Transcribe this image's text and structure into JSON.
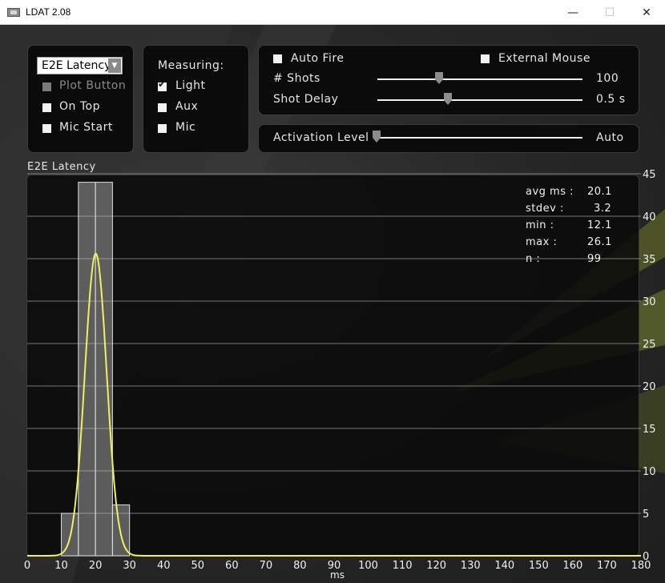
{
  "window": {
    "title": "LDAT 2.08",
    "minimize": "—",
    "maximize": "☐",
    "close": "✕"
  },
  "colors": {
    "accent_curve": "#f0f060",
    "bar_fill": "#bdbdbd",
    "panel": "#0b0b0b"
  },
  "left_panel": {
    "dropdown_value": "E2E Latency",
    "plot_button": "Plot Button",
    "on_top": "On Top",
    "mic_start": "Mic Start"
  },
  "measuring": {
    "title": "Measuring:",
    "light": "Light",
    "aux": "Aux",
    "mic": "Mic",
    "light_checked": true
  },
  "controls": {
    "auto_fire": "Auto Fire",
    "external_mouse": "External Mouse",
    "shots_label": "# Shots",
    "shots_value": "100",
    "shot_delay_label": "Shot Delay",
    "shot_delay_value": "0.5  s",
    "activation_label": "Activation Level",
    "activation_value": "Auto"
  },
  "chart_title": "E2E Latency",
  "stats": {
    "avg_label": "avg ms :",
    "avg": "20.1",
    "stdev_label": "stdev :",
    "stdev": "3.2",
    "min_label": "min :",
    "min": "12.1",
    "max_label": "max :",
    "max": "26.1",
    "n_label": "n :",
    "n": "99"
  },
  "chart_data": {
    "type": "bar",
    "xlabel": "ms",
    "ylabel": "",
    "xlim": [
      0,
      180
    ],
    "ylim": [
      0,
      45
    ],
    "x_ticks": [
      0,
      10,
      20,
      30,
      40,
      50,
      60,
      70,
      80,
      90,
      100,
      110,
      120,
      130,
      140,
      150,
      160,
      170,
      180
    ],
    "y_ticks": [
      0,
      5,
      10,
      15,
      20,
      25,
      30,
      35,
      40,
      45
    ],
    "bins": [
      {
        "start": 10,
        "end": 15,
        "count": 5
      },
      {
        "start": 15,
        "end": 20,
        "count": 44
      },
      {
        "start": 20,
        "end": 25,
        "count": 44
      },
      {
        "start": 25,
        "end": 30,
        "count": 6
      }
    ],
    "fit_curve": {
      "type": "normal",
      "mean": 20.1,
      "stdev": 3.2,
      "peak": 35.6
    },
    "grid": true
  }
}
